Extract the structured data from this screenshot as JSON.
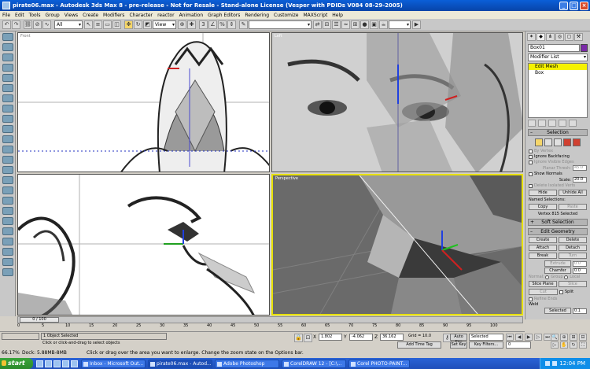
{
  "window": {
    "title": "pirate06.max - Autodesk 3ds Max 8 - pre-release - Not for Resale - Stand-alone License (Vesper with PDIDs V084 08-29-2005)"
  },
  "menu": [
    "File",
    "Edit",
    "Tools",
    "Group",
    "Views",
    "Create",
    "Modifiers",
    "Character",
    "reactor",
    "Animation",
    "Graph Editors",
    "Rendering",
    "Customize",
    "MAXScript",
    "Help"
  ],
  "toolbar": {
    "selection_filter": "All",
    "ref_coord": "View"
  },
  "viewports": {
    "top_left": "Front",
    "top_right": "Left",
    "perspective": "Perspective"
  },
  "command_panel": {
    "object_name": "Box01",
    "modifier_list": "Modifier List",
    "stack": [
      "Edit Mesh",
      "Box"
    ],
    "selection": {
      "title": "Selection",
      "by_vertex": "By Vertex",
      "ignore_backfacing": "Ignore Backfacing",
      "ignore_visible_edges": "Ignore Visible Edges",
      "planar_thresh_label": "Planar Thresh:",
      "planar_thresh": "45.0",
      "show_normals": "Show Normals",
      "scale_label": "Scale:",
      "scale": "20.0",
      "delete_isolated": "Delete Isolated Verts",
      "hide": "Hide",
      "unhide_all": "Unhide All",
      "named_selections": "Named Selections:",
      "copy": "Copy",
      "paste": "Paste",
      "status": "Vertex 815 Selected"
    },
    "soft_selection": "Soft Selection",
    "edit_geometry": {
      "title": "Edit Geometry",
      "create": "Create",
      "delete": "Delete",
      "attach": "Attach",
      "detach": "Detach",
      "break": "Break",
      "turn": "Turn",
      "extrude": "Extrude",
      "extrude_val": "0.0",
      "chamfer": "Chamfer",
      "chamfer_val": "0.0",
      "normal": "Normal:",
      "group": "Group",
      "local": "Local",
      "slice_plane": "Slice Plane",
      "slice": "Slice",
      "cut": "Cut",
      "split": "Split",
      "refine_ends": "Refine Ends",
      "weld": "Weld",
      "selected": "Selected",
      "selected_val": "0.1"
    }
  },
  "timeline": {
    "slider": "0 / 100",
    "ticks": [
      "0",
      "5",
      "10",
      "15",
      "20",
      "25",
      "30",
      "35",
      "40",
      "45",
      "50",
      "55",
      "60",
      "65",
      "70",
      "75",
      "80",
      "85",
      "90",
      "95",
      "100"
    ]
  },
  "status": {
    "selected": "1 Object Selected",
    "prompt": "Click or click-and-drag to select objects",
    "x_label": "X",
    "x": "1.802",
    "y_label": "Y",
    "y": "-4.062",
    "z_label": "Z",
    "z": "36.162",
    "grid": "Grid = 10.0",
    "add_time_tag": "Add Time Tag",
    "auto_key": "Auto Key",
    "set_key": "Set Key",
    "selected_dropdown": "Selected",
    "key_filters": "Key Filters...",
    "frame": "0",
    "cmd_left": "66.17%",
    "cmd_left2": "Dock: 5.88MB-8MB"
  },
  "bottom_prompt": "Click or drag over the area you want to enlarge. Change the zoom state on the Options bar.",
  "taskbar": {
    "start": "start",
    "tasks": [
      "Inbox - Microsoft Out...",
      "pirate06.max - Autod...",
      "Adobe Photoshop",
      "CorelDRAW 12 - [C:\\...",
      "Corel PHOTO-PAINT..."
    ],
    "clock": "12:04 PM"
  }
}
